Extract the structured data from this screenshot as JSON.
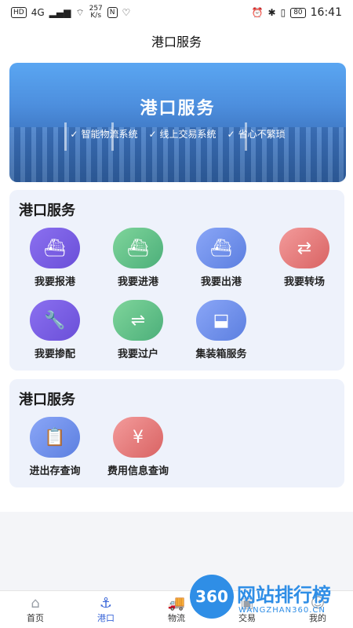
{
  "status_bar": {
    "network": "HD",
    "signal": "4G",
    "speed_value": "257",
    "speed_unit": "K/s",
    "nfc": "N",
    "battery": "80",
    "time": "16:41"
  },
  "header": {
    "title": "港口服务"
  },
  "banner": {
    "title": "港口服务",
    "tags": [
      "智能物流系统",
      "线上交易系统",
      "省心不繁琐"
    ],
    "check_glyph": "✓"
  },
  "card1": {
    "title": "港口服务",
    "items": [
      {
        "label": "我要报港",
        "icon": "ship-report-icon",
        "glyph": "⛴",
        "color": "purple"
      },
      {
        "label": "我要进港",
        "icon": "ship-enter-icon",
        "glyph": "⛴",
        "color": "green"
      },
      {
        "label": "我要出港",
        "icon": "ship-exit-icon",
        "glyph": "⛴",
        "color": "blue"
      },
      {
        "label": "我要转场",
        "icon": "transfer-icon",
        "glyph": "⇄",
        "color": "red"
      },
      {
        "label": "我要掺配",
        "icon": "wrench-icon",
        "glyph": "🔧",
        "color": "purple"
      },
      {
        "label": "我要过户",
        "icon": "swap-arrows-icon",
        "glyph": "⇌",
        "color": "green"
      },
      {
        "label": "集装箱服务",
        "icon": "container-crane-icon",
        "glyph": "⬓",
        "color": "blue"
      }
    ]
  },
  "card2": {
    "title": "港口服务",
    "items": [
      {
        "label": "进出存查询",
        "icon": "clipboard-icon",
        "glyph": "📋",
        "color": "blue"
      },
      {
        "label": "费用信息查询",
        "icon": "yuan-money-icon",
        "glyph": "¥",
        "color": "red"
      }
    ]
  },
  "tabbar": {
    "tabs": [
      {
        "label": "首页",
        "icon": "home-icon",
        "glyph": "⌂",
        "active": false
      },
      {
        "label": "港口",
        "icon": "anchor-icon",
        "glyph": "⚓",
        "active": true
      },
      {
        "label": "物流",
        "icon": "truck-icon",
        "glyph": "🚚",
        "active": false
      },
      {
        "label": "交易",
        "icon": "trade-icon",
        "glyph": "▣",
        "active": false
      },
      {
        "label": "我的",
        "icon": "user-icon",
        "glyph": "☺",
        "active": false
      }
    ]
  },
  "watermark": {
    "circle_text": "360",
    "title": "网站排行榜",
    "subtitle": "WANGZHAN360.CN"
  }
}
